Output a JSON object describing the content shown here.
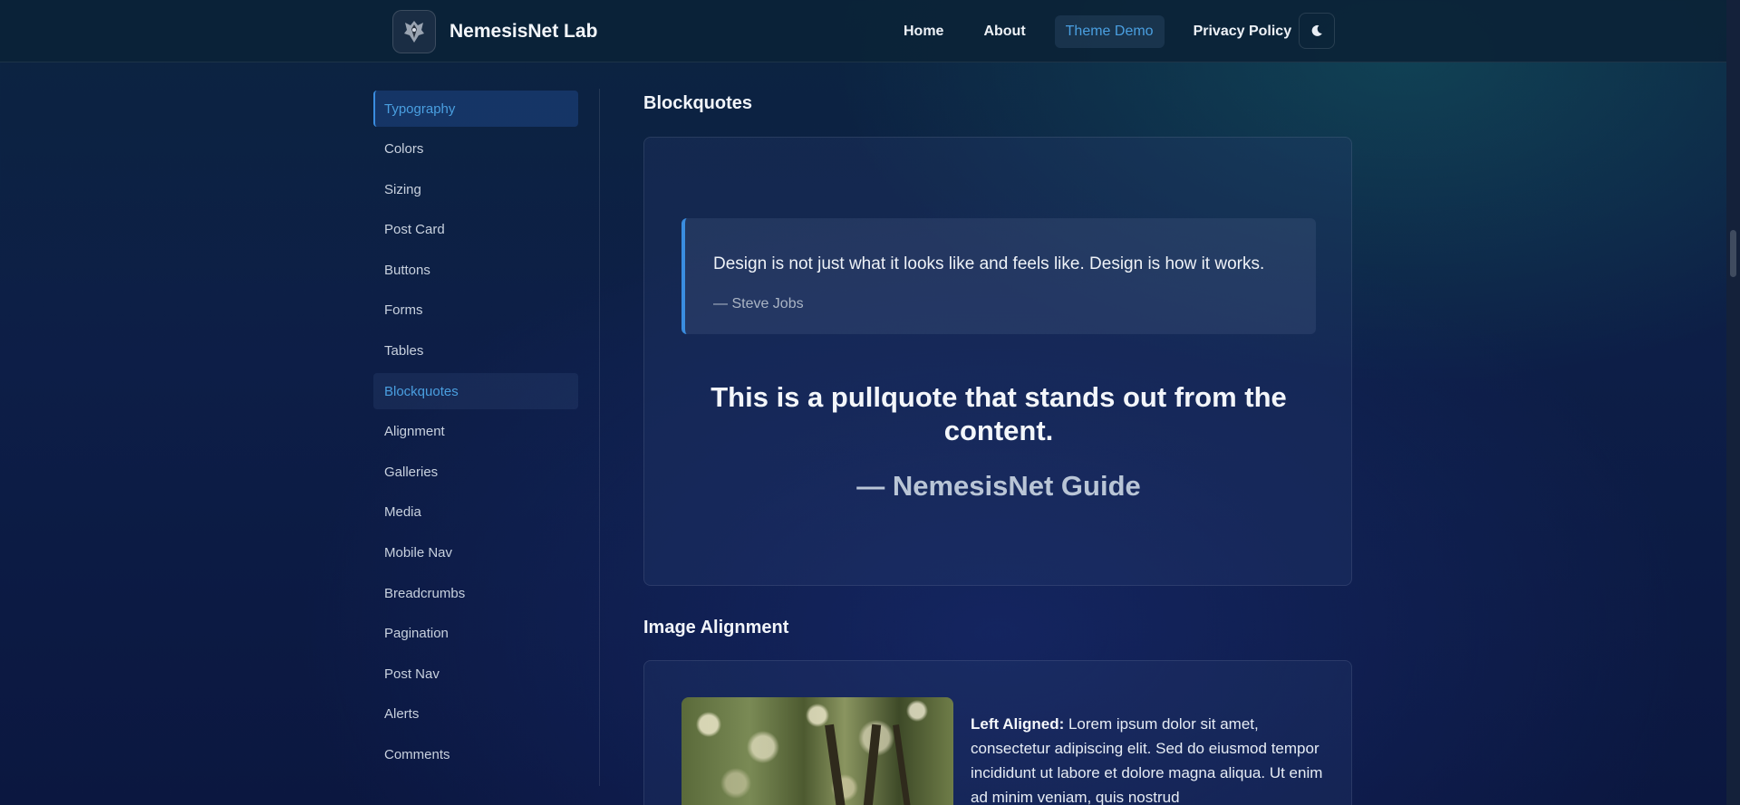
{
  "header": {
    "brand_name": "NemesisNet Lab",
    "nav": [
      {
        "label": "Home",
        "active": false
      },
      {
        "label": "About",
        "active": false
      },
      {
        "label": "Theme Demo",
        "active": true
      },
      {
        "label": "Privacy Policy",
        "active": false
      }
    ],
    "theme_toggle_icon": "moon-icon"
  },
  "sidebar": {
    "items": [
      {
        "label": "Typography",
        "state": "current"
      },
      {
        "label": "Colors"
      },
      {
        "label": "Sizing"
      },
      {
        "label": "Post Card"
      },
      {
        "label": "Buttons"
      },
      {
        "label": "Forms"
      },
      {
        "label": "Tables"
      },
      {
        "label": "Blockquotes",
        "state": "highlighted"
      },
      {
        "label": "Alignment"
      },
      {
        "label": "Galleries"
      },
      {
        "label": "Media"
      },
      {
        "label": "Mobile Nav"
      },
      {
        "label": "Breadcrumbs"
      },
      {
        "label": "Pagination"
      },
      {
        "label": "Post Nav"
      },
      {
        "label": "Alerts"
      },
      {
        "label": "Comments"
      }
    ]
  },
  "blockquotes": {
    "title": "Blockquotes",
    "quote": "Design is not just what it looks like and feels like. Design is how it works.",
    "cite": "— Steve Jobs",
    "pullquote": "This is a pullquote that stands out from the content.",
    "pullquote_cite": "— NemesisNet Guide"
  },
  "image_alignment": {
    "title": "Image Alignment",
    "label": "Left Aligned:",
    "text": " Lorem ipsum dolor sit amet, consectetur adipiscing elit. Sed do eiusmod tempor incididunt ut labore et dolore magna aliqua. Ut enim ad minim veniam, quis nostrud"
  },
  "colors": {
    "accent": "#4a9fe0",
    "accent_border": "#3a8de0"
  }
}
